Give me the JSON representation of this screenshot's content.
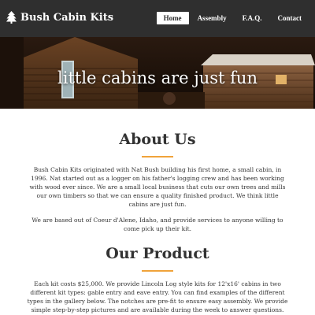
{
  "navbar": {
    "brand": "Bush Cabin Kits",
    "brand_icon": "tree-icon",
    "items": [
      {
        "label": "Home",
        "active": true
      },
      {
        "label": "Assembly",
        "active": false
      },
      {
        "label": "F.A.Q.",
        "active": false
      },
      {
        "label": "Contact",
        "active": false
      }
    ]
  },
  "hero": {
    "title": "little cabins are just fun"
  },
  "about": {
    "heading": "About Us",
    "paragraph1": "Bush Cabin Kits originated with Nat Bush building his first home, a small cabin, in 1996. Nat started out as a logger on his father's logging crew and has been working with wood ever since. We are a small local business that cuts our own trees and mills our own timbers so that we can ensure a quality finished product. We think little cabins are just fun.",
    "paragraph2": "We are based out of Coeur d'Alene, Idaho, and provide services to anyone willing to come pick up their kit."
  },
  "product": {
    "heading": "Our Product",
    "paragraph1": "Each kit costs $25,000. We provide Lincoln Log style kits for 12'x16' cabins in two different kit types: gable entry and eave entry. You can find examples of the different types in the gallery below. The notches are pre-fit to ensure easy assembly. We provide simple step-by-step pictures and are available during the week to answer questions."
  },
  "colors": {
    "navbar_bg": "#2f2f2f",
    "accent": "#f0a33a"
  }
}
